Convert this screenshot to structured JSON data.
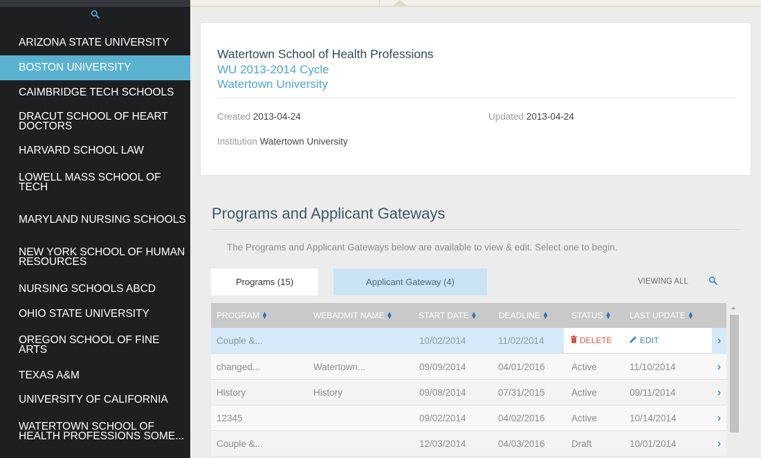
{
  "sidebar": {
    "search_icon": "search-icon",
    "accent_color": "#5ab2d0",
    "items": [
      {
        "label": "ARIZONA STATE UNIVERSITY",
        "active": false
      },
      {
        "label": "BOSTON UNIVERSITY",
        "active": true
      },
      {
        "label": "CAIMBRIDGE TECH SCHOOLS",
        "active": false
      },
      {
        "label": "DRACUT SCHOOL OF HEART DOCTORS",
        "active": false
      },
      {
        "label": "HARVARD SCHOOL LAW",
        "active": false
      },
      {
        "label": "LOWELL MASS SCHOOL OF TECH",
        "active": false
      },
      {
        "label": "MARYLAND NURSING SCHOOLS",
        "active": false
      },
      {
        "label": "NEW YORK SCHOOL OF HUMAN RESOURCES",
        "active": false
      },
      {
        "label": "NURSING SCHOOLS ABCD",
        "active": false
      },
      {
        "label": "OHIO STATE UNIVERSITY",
        "active": false
      },
      {
        "label": "OREGON SCHOOL OF FINE ARTS",
        "active": false
      },
      {
        "label": "TEXAS A&M",
        "active": false
      },
      {
        "label": "UNIVERSITY OF CALIFORNIA",
        "active": false
      },
      {
        "label": "WATERTOWN SCHOOL OF HEALTH PROFESSIONS SOME...",
        "active": false
      }
    ]
  },
  "card": {
    "title": "Watertown School of Health Professions",
    "cycle": "WU 2013-2014 Cycle",
    "university": "Watertown University",
    "created_label": "Created",
    "created_value": "2013-04-24",
    "updated_label": "Updated",
    "updated_value": "2013-04-24",
    "institution_label": "Institution",
    "institution_value": "Watertown University"
  },
  "section": {
    "title": "Programs and Applicant Gateways",
    "description": "The Programs and Applicant Gateways below are available to view & edit. Select one to begin."
  },
  "tabs": {
    "programs": "Programs (15)",
    "gateway": "Applicant Gateway (4)",
    "viewing": "VIEWING ALL"
  },
  "table": {
    "columns": [
      "PROGRAM",
      "WEBADMIT NAME",
      "START DATE",
      "DEADLINE",
      "STATUS",
      "LAST UPDATE"
    ],
    "delete_label": "DELETE",
    "edit_label": "EDIT",
    "rows": [
      {
        "program": "Couple &...",
        "webadmit": "",
        "start": "10/02/2014",
        "deadline": "11/02/2014",
        "status": "",
        "updated": "",
        "selected": true
      },
      {
        "program": "changed...",
        "webadmit": "Watertown...",
        "start": "09/09/2014",
        "deadline": "04/01/2016",
        "status": "Active",
        "updated": "11/10/2014",
        "selected": false
      },
      {
        "program": "History",
        "webadmit": "History",
        "start": "09/08/2014",
        "deadline": "07/31/2015",
        "status": "Active",
        "updated": "09/11/2014",
        "selected": false
      },
      {
        "program": "12345",
        "webadmit": "",
        "start": "09/02/2014",
        "deadline": "04/02/2016",
        "status": "Active",
        "updated": "10/14/2014",
        "selected": false
      },
      {
        "program": "Couple &...",
        "webadmit": "",
        "start": "12/03/2014",
        "deadline": "04/03/2016",
        "status": "Draft",
        "updated": "10/01/2014",
        "selected": false
      }
    ]
  }
}
